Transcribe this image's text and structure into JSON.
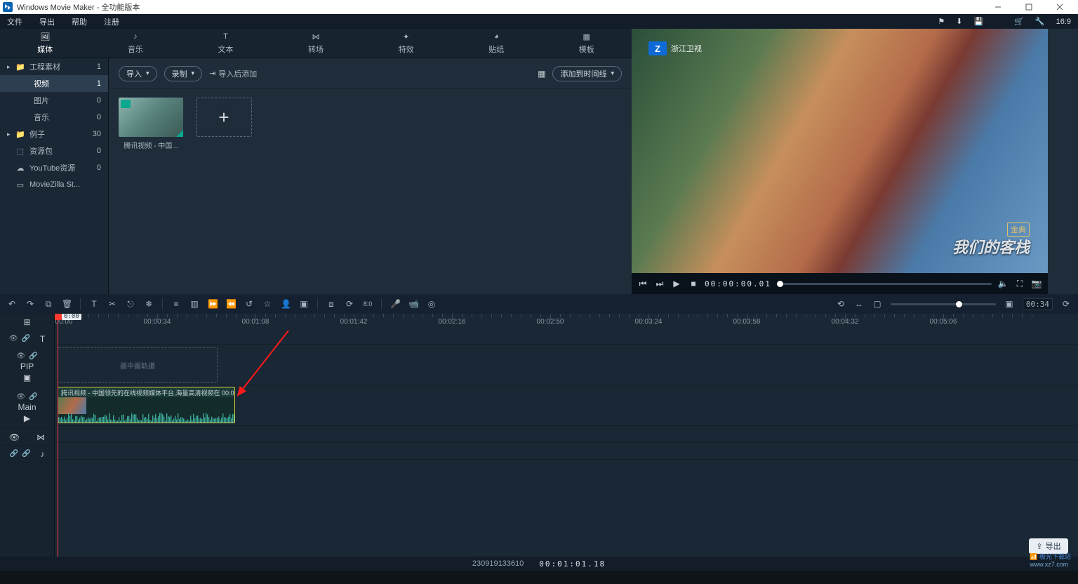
{
  "window": {
    "title": "Windows Movie Maker  - 全功能版本"
  },
  "menus": {
    "file": "文件",
    "export": "导出",
    "help": "帮助",
    "register": "注册"
  },
  "topright": {
    "ratio": "16:9"
  },
  "cat_tabs": [
    "媒体",
    "音乐",
    "文本",
    "转场",
    "特效",
    "贴纸",
    "模板"
  ],
  "content_bar": {
    "import": "导入",
    "record": "录制",
    "import_add": "导入后添加",
    "add_timeline": "添加到时间线"
  },
  "sidebar": {
    "items": [
      {
        "label": "工程素材",
        "count": "1",
        "caret": "▸",
        "type": "folder",
        "sel": false,
        "indent": false
      },
      {
        "label": "视频",
        "count": "1",
        "caret": "",
        "type": "",
        "sel": true,
        "indent": true
      },
      {
        "label": "图片",
        "count": "0",
        "caret": "",
        "type": "",
        "sel": false,
        "indent": true
      },
      {
        "label": "音乐",
        "count": "0",
        "caret": "",
        "type": "",
        "sel": false,
        "indent": true
      },
      {
        "label": "例子",
        "count": "30",
        "caret": "▸",
        "type": "folder",
        "sel": false,
        "indent": false
      },
      {
        "label": "资源包",
        "count": "0",
        "caret": "",
        "type": "cube",
        "sel": false,
        "indent": false
      },
      {
        "label": "YouTube资源",
        "count": "0",
        "caret": "",
        "type": "cloud",
        "sel": false,
        "indent": false
      },
      {
        "label": "MovieZilla St...",
        "count": "",
        "caret": "",
        "type": "card",
        "sel": false,
        "indent": false
      }
    ]
  },
  "thumb": {
    "caption": "腾讯视频 - 中国..."
  },
  "preview": {
    "watermark": "浙江卫视",
    "stamp": "我们的客栈",
    "stamp2": "金典"
  },
  "player": {
    "tc": "00:00:00.01"
  },
  "timeline": {
    "pip_label": "PIP",
    "main_label": "Main",
    "pip_hint": "画中画轨道",
    "clip_title": "腾讯视频 - 中国领先的在线视频媒体平台,海量高清视频在  00:0",
    "playhead_tip": "0:00",
    "ruler": [
      "00:00:00",
      "00:00:34",
      "00:01:08",
      "00:01:42",
      "00:02:16",
      "00:02:50",
      "00:03:24",
      "00:03:58",
      "00:04:32",
      "00:05:06"
    ],
    "zoom_time": "00:34"
  },
  "status": {
    "id": "230919133610",
    "tc": "00:01:01.18"
  },
  "export_btn": "导出"
}
